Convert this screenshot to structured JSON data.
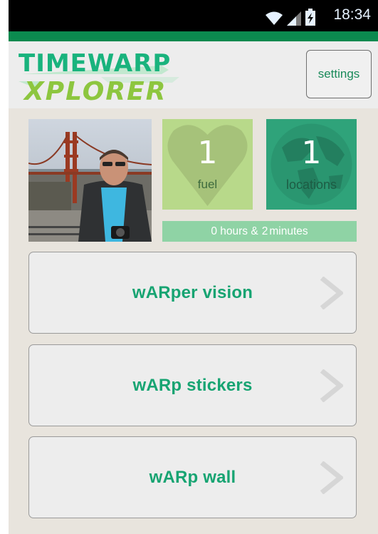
{
  "status_bar": {
    "time": "18:34",
    "icons": [
      "wifi-icon",
      "signal-icon",
      "battery-charging-icon"
    ]
  },
  "header": {
    "logo_line1": "TIMEWARP",
    "logo_line2": "XPLORER",
    "settings_label": "settings"
  },
  "stats": {
    "fuel_value": "1",
    "fuel_label": "fuel",
    "locations_value": "1",
    "locations_label": "locations",
    "time_prefix": "0 hours &",
    "time_minutes": "2",
    "time_suffix": "minutes"
  },
  "menu": [
    {
      "label": "wARper vision"
    },
    {
      "label": "wARp stickers"
    },
    {
      "label": "wARp wall"
    }
  ],
  "colors": {
    "brand_green": "#17a472",
    "fuel_tile": "#b8d98a",
    "locations_tile": "#2fa37a",
    "time_bar": "#8fd3a5",
    "accent_bar": "#0b8a4f"
  }
}
